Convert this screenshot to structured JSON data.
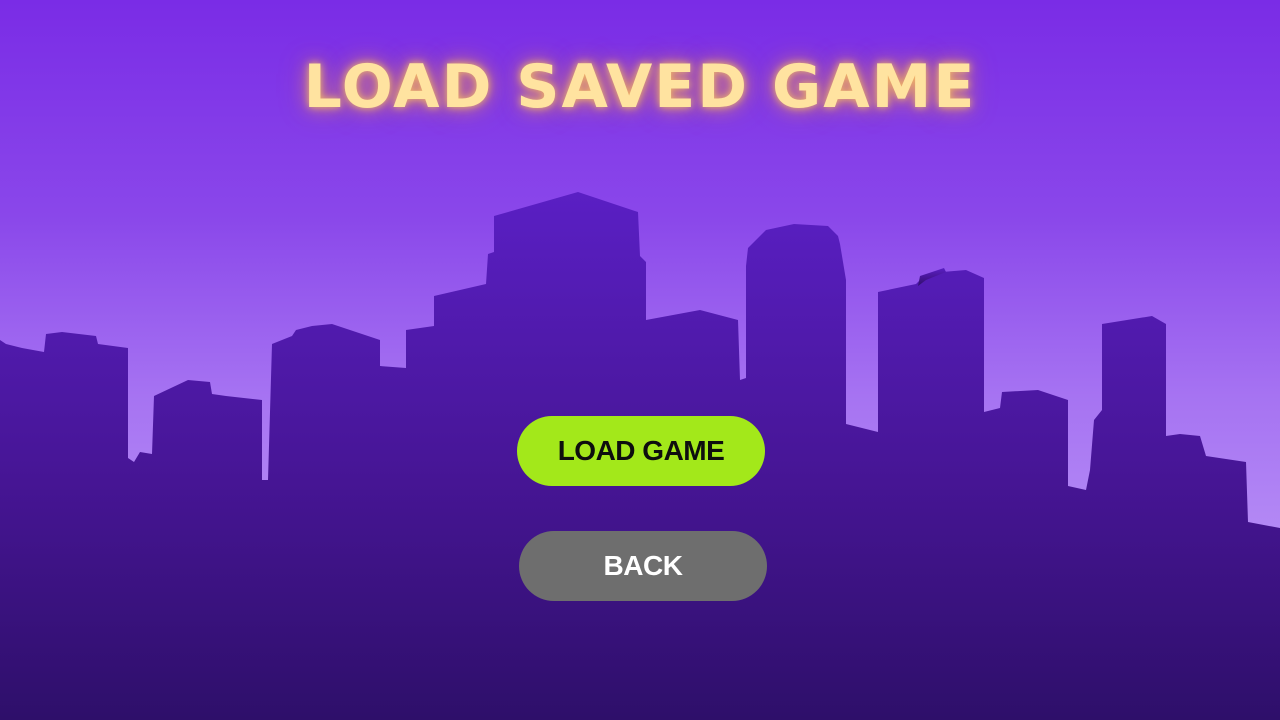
{
  "screen": {
    "title": "LOAD SAVED GAME"
  },
  "buttons": {
    "load_label": "LOAD GAME",
    "back_label": "BACK"
  },
  "colors": {
    "sky_top": "#7a2ce6",
    "sky_bottom": "#c9a4f8",
    "skyline_top": "#5a1fc4",
    "skyline_bottom": "#2e0f6a",
    "title_glow": "#ffe3a0",
    "load_button": "#a3e81a",
    "back_button": "#6e6e6e"
  },
  "icons": {
    "background": "city-skyline-silhouette"
  }
}
